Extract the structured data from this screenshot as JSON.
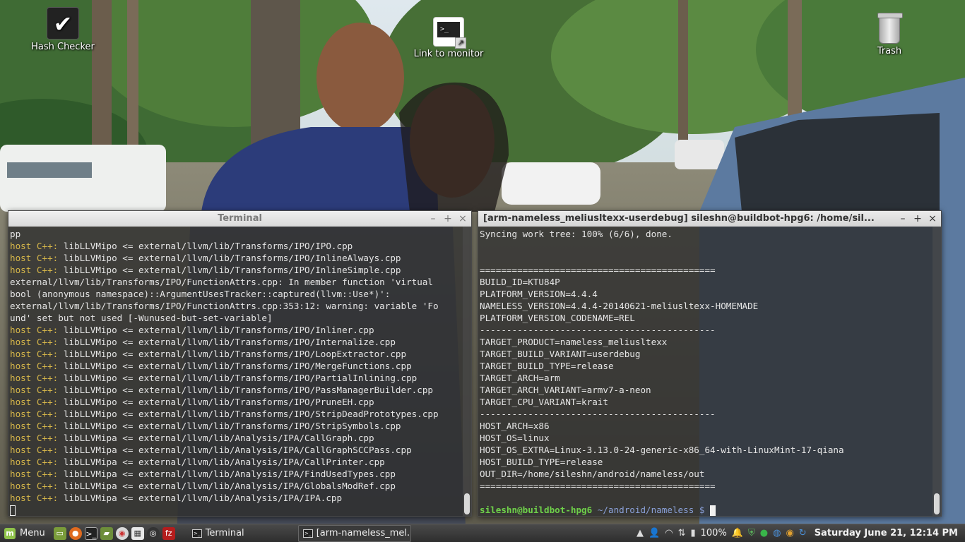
{
  "desktop": {
    "icons": [
      {
        "label": "Hash Checker",
        "icon": "checkmark-icon"
      },
      {
        "label": "Link to monitor",
        "icon": "terminal-link-icon"
      },
      {
        "label": "Trash",
        "icon": "trash-icon"
      }
    ]
  },
  "left_terminal": {
    "title": "Terminal",
    "lines": [
      {
        "prefix": "",
        "text": "pp"
      },
      {
        "prefix": "host C++:",
        "text": " libLLVMipo <= external/llvm/lib/Transforms/IPO/IPO.cpp"
      },
      {
        "prefix": "host C++:",
        "text": " libLLVMipo <= external/llvm/lib/Transforms/IPO/InlineAlways.cpp"
      },
      {
        "prefix": "host C++:",
        "text": " libLLVMipo <= external/llvm/lib/Transforms/IPO/InlineSimple.cpp"
      },
      {
        "prefix": "",
        "text": "external/llvm/lib/Transforms/IPO/FunctionAttrs.cpp: In member function 'virtual"
      },
      {
        "prefix": "",
        "text": "bool (anonymous namespace)::ArgumentUsesTracker::captured(llvm::Use*)':"
      },
      {
        "prefix": "",
        "text": "external/llvm/lib/Transforms/IPO/FunctionAttrs.cpp:353:12: warning: variable 'Fo"
      },
      {
        "prefix": "",
        "text": "und' set but not used [-Wunused-but-set-variable]"
      },
      {
        "prefix": "host C++:",
        "text": " libLLVMipo <= external/llvm/lib/Transforms/IPO/Inliner.cpp"
      },
      {
        "prefix": "host C++:",
        "text": " libLLVMipo <= external/llvm/lib/Transforms/IPO/Internalize.cpp"
      },
      {
        "prefix": "host C++:",
        "text": " libLLVMipo <= external/llvm/lib/Transforms/IPO/LoopExtractor.cpp"
      },
      {
        "prefix": "host C++:",
        "text": " libLLVMipo <= external/llvm/lib/Transforms/IPO/MergeFunctions.cpp"
      },
      {
        "prefix": "host C++:",
        "text": " libLLVMipo <= external/llvm/lib/Transforms/IPO/PartialInlining.cpp"
      },
      {
        "prefix": "host C++:",
        "text": " libLLVMipo <= external/llvm/lib/Transforms/IPO/PassManagerBuilder.cpp"
      },
      {
        "prefix": "host C++:",
        "text": " libLLVMipo <= external/llvm/lib/Transforms/IPO/PruneEH.cpp"
      },
      {
        "prefix": "host C++:",
        "text": " libLLVMipo <= external/llvm/lib/Transforms/IPO/StripDeadPrototypes.cpp"
      },
      {
        "prefix": "host C++:",
        "text": " libLLVMipo <= external/llvm/lib/Transforms/IPO/StripSymbols.cpp"
      },
      {
        "prefix": "host C++:",
        "text": " libLLVMipa <= external/llvm/lib/Analysis/IPA/CallGraph.cpp"
      },
      {
        "prefix": "host C++:",
        "text": " libLLVMipa <= external/llvm/lib/Analysis/IPA/CallGraphSCCPass.cpp"
      },
      {
        "prefix": "host C++:",
        "text": " libLLVMipa <= external/llvm/lib/Analysis/IPA/CallPrinter.cpp"
      },
      {
        "prefix": "host C++:",
        "text": " libLLVMipa <= external/llvm/lib/Analysis/IPA/FindUsedTypes.cpp"
      },
      {
        "prefix": "host C++:",
        "text": " libLLVMipa <= external/llvm/lib/Analysis/IPA/GlobalsModRef.cpp"
      },
      {
        "prefix": "host C++:",
        "text": " libLLVMipa <= external/llvm/lib/Analysis/IPA/IPA.cpp"
      }
    ]
  },
  "right_terminal": {
    "title": "[arm-nameless_meliusltexx-userdebug] sileshn@buildbot-hpg6: /home/sil...",
    "lines": [
      "Syncing work tree: 100% (6/6), done.",
      "",
      "",
      "============================================",
      "BUILD_ID=KTU84P",
      "PLATFORM_VERSION=4.4.4",
      "NAMELESS_VERSION=4.4.4-20140621-meliusltexx-HOMEMADE",
      "PLATFORM_VERSION_CODENAME=REL",
      "--------------------------------------------",
      "TARGET_PRODUCT=nameless_meliusltexx",
      "TARGET_BUILD_VARIANT=userdebug",
      "TARGET_BUILD_TYPE=release",
      "TARGET_ARCH=arm",
      "TARGET_ARCH_VARIANT=armv7-a-neon",
      "TARGET_CPU_VARIANT=krait",
      "--------------------------------------------",
      "HOST_ARCH=x86",
      "HOST_OS=linux",
      "HOST_OS_EXTRA=Linux-3.13.0-24-generic-x86_64-with-LinuxMint-17-qiana",
      "HOST_BUILD_TYPE=release",
      "OUT_DIR=/home/sileshn/android/nameless/out",
      "============================================",
      ""
    ],
    "prompt_user": "sileshn@buildbot-hpg6",
    "prompt_path": " ~/android/nameless $ "
  },
  "taskbar": {
    "menu_label": "Menu",
    "tasks": [
      "Terminal",
      "[arm-nameless_mel..."
    ],
    "battery": "100%",
    "clock": "Saturday June 21, 12:14 PM"
  },
  "colors": {
    "host_prefix": "#d8b84a",
    "prompt_user": "#6fd14a",
    "prompt_path": "#8aa0d8"
  }
}
